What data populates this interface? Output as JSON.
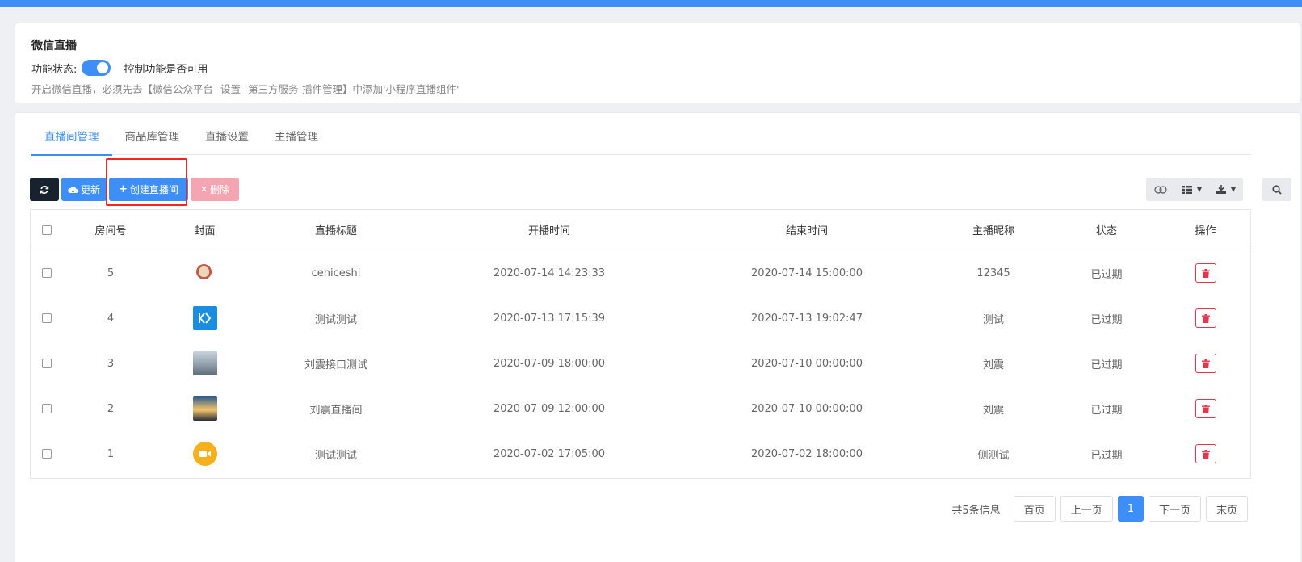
{
  "module": {
    "title": "微信直播",
    "status_label": "功能状态:",
    "toggle_on": true,
    "toggle_desc": "控制功能是否可用",
    "note": "开启微信直播，必须先去【微信公众平台--设置--第三方服务-插件管理】中添加'小程序直播组件'"
  },
  "tabs": [
    {
      "label": "直播间管理",
      "active": true
    },
    {
      "label": "商品库管理",
      "active": false
    },
    {
      "label": "直播设置",
      "active": false
    },
    {
      "label": "主播管理",
      "active": false
    }
  ],
  "toolbar": {
    "refresh_icon": "refresh-icon",
    "update_label": "更新",
    "create_label": "创建直播间",
    "delete_label": "删除"
  },
  "table": {
    "headers": [
      "房间号",
      "封面",
      "直播标题",
      "开播时间",
      "结束时间",
      "主播昵称",
      "状态",
      "操作"
    ],
    "rows": [
      {
        "room": "5",
        "title": "cehiceshi",
        "start": "2020-07-14 14:23:33",
        "end": "2020-07-14 15:00:00",
        "anchor": "12345",
        "status": "已过期"
      },
      {
        "room": "4",
        "title": "测试测试",
        "start": "2020-07-13 17:15:39",
        "end": "2020-07-13 19:02:47",
        "anchor": "测试",
        "status": "已过期"
      },
      {
        "room": "3",
        "title": "刘震接口测试",
        "start": "2020-07-09 18:00:00",
        "end": "2020-07-10 00:00:00",
        "anchor": "刘震",
        "status": "已过期"
      },
      {
        "room": "2",
        "title": "刘震直播间",
        "start": "2020-07-09 12:00:00",
        "end": "2020-07-10 00:00:00",
        "anchor": "刘震",
        "status": "已过期"
      },
      {
        "room": "1",
        "title": "测试测试",
        "start": "2020-07-02 17:05:00",
        "end": "2020-07-02 18:00:00",
        "anchor": "侧测试",
        "status": "已过期"
      }
    ]
  },
  "pagination": {
    "info": "共5条信息",
    "first": "首页",
    "prev": "上一页",
    "current": "1",
    "next": "下一页",
    "last": "末页"
  },
  "colors": {
    "accent": "#3e8ef7",
    "danger": "#e8334f"
  }
}
